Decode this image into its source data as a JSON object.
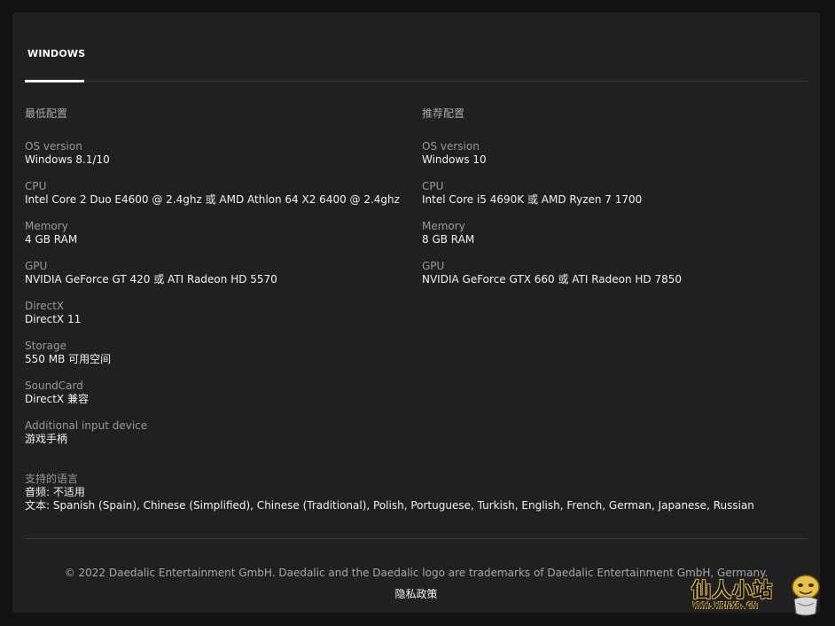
{
  "tabs": [
    {
      "label": "WINDOWS",
      "active": true
    }
  ],
  "minimum": {
    "heading": "最低配置",
    "specs": [
      {
        "label": "OS version",
        "value": "Windows 8.1/10"
      },
      {
        "label": "CPU",
        "value": "Intel Core 2 Duo E4600 @ 2.4ghz 或 AMD Athlon 64 X2 6400 @ 2.4ghz"
      },
      {
        "label": "Memory",
        "value": "4 GB RAM"
      },
      {
        "label": "GPU",
        "value": "NVIDIA GeForce GT 420 或 ATI Radeon HD 5570"
      },
      {
        "label": "DirectX",
        "value": "DirectX 11"
      },
      {
        "label": "Storage",
        "value": "550 MB 可用空间"
      },
      {
        "label": "SoundCard",
        "value": "DirectX 兼容"
      },
      {
        "label": "Additional input device",
        "value": "游戏手柄"
      }
    ]
  },
  "recommended": {
    "heading": "推荐配置",
    "specs": [
      {
        "label": "OS version",
        "value": "Windows 10"
      },
      {
        "label": "CPU",
        "value": "Intel Core i5 4690K 或 AMD Ryzen 7 1700"
      },
      {
        "label": "Memory",
        "value": "8 GB RAM"
      },
      {
        "label": "GPU",
        "value": "NVIDIA GeForce GTX 660 或 ATI Radeon HD 7850"
      }
    ]
  },
  "languages": {
    "heading": "支持的语言",
    "audio": "音频: 不适用",
    "text": "文本: Spanish (Spain), Chinese (Simplified), Chinese (Traditional), Polish, Portuguese, Turkish, English, French, German, Japanese, Russian"
  },
  "footer": {
    "copyright": "© 2022 Daedalic Entertainment GmbH. Daedalic and the Daedalic logo are trademarks of Daedalic Entertainment GmbH, Germany.",
    "privacy_label": "隐私政策"
  },
  "watermark": {
    "title": "仙人小站",
    "url": "WWW.WRNXR.CN",
    "mascot_icon": "mascot-icon"
  },
  "colors": {
    "page_bg": "#121212",
    "panel_bg": "#202020",
    "label": "#9a9a9a",
    "value": "#f2f2f2",
    "divider": "#3a3a3a"
  }
}
